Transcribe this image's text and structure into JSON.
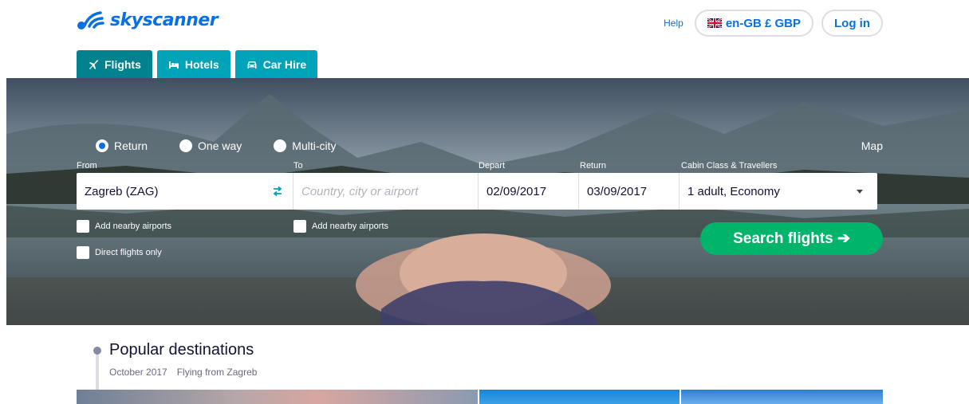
{
  "brand": {
    "name": "skyscanner",
    "color": "#0770e3"
  },
  "header": {
    "help_label": "Help",
    "locale_label": "en-GB £ GBP",
    "login_label": "Log in"
  },
  "tabs": [
    {
      "label": "Flights",
      "icon": "plane-icon",
      "active": true
    },
    {
      "label": "Hotels",
      "icon": "bed-icon",
      "active": false
    },
    {
      "label": "Car Hire",
      "icon": "car-icon",
      "active": false
    }
  ],
  "search": {
    "trip_types": [
      {
        "label": "Return",
        "selected": true
      },
      {
        "label": "One way",
        "selected": false
      },
      {
        "label": "Multi-city",
        "selected": false
      }
    ],
    "map_label": "Map",
    "labels": {
      "from": "From",
      "to": "To",
      "depart": "Depart",
      "return": "Return",
      "cabin": "Cabin Class & Travellers"
    },
    "from_value": "Zagreb (ZAG)",
    "to_placeholder": "Country, city or airport",
    "depart_value": "02/09/2017",
    "return_value": "03/09/2017",
    "cabin_value": "1 adult, Economy",
    "nearby_from_label": "Add nearby airports",
    "nearby_to_label": "Add nearby airports",
    "direct_label": "Direct flights only",
    "search_button_label": "Search flights ➔",
    "search_button_color": "#00b56b"
  },
  "popular": {
    "title": "Popular destinations",
    "month": "October 2017",
    "origin": "Flying from Zagreb"
  }
}
